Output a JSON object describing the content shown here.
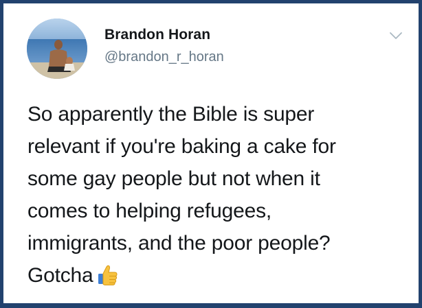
{
  "tweet": {
    "author": {
      "display_name": "Brandon Horan",
      "handle": "@brandon_r_horan",
      "avatar": "person-sitting-at-beach-photo"
    },
    "menu_icon": "chevron-down-icon",
    "text_lines": [
      "So apparently the Bible is super",
      "relevant if you're baking a cake for",
      "some gay people but not when it",
      "comes to helping refugees,",
      "immigrants, and the poor people?",
      "Gotcha"
    ],
    "emoji": "thumbs-up-emoji"
  },
  "colors": {
    "border": "#22426e",
    "card_background": "#ffffff",
    "text_primary": "#14171a",
    "text_secondary": "#657786"
  }
}
